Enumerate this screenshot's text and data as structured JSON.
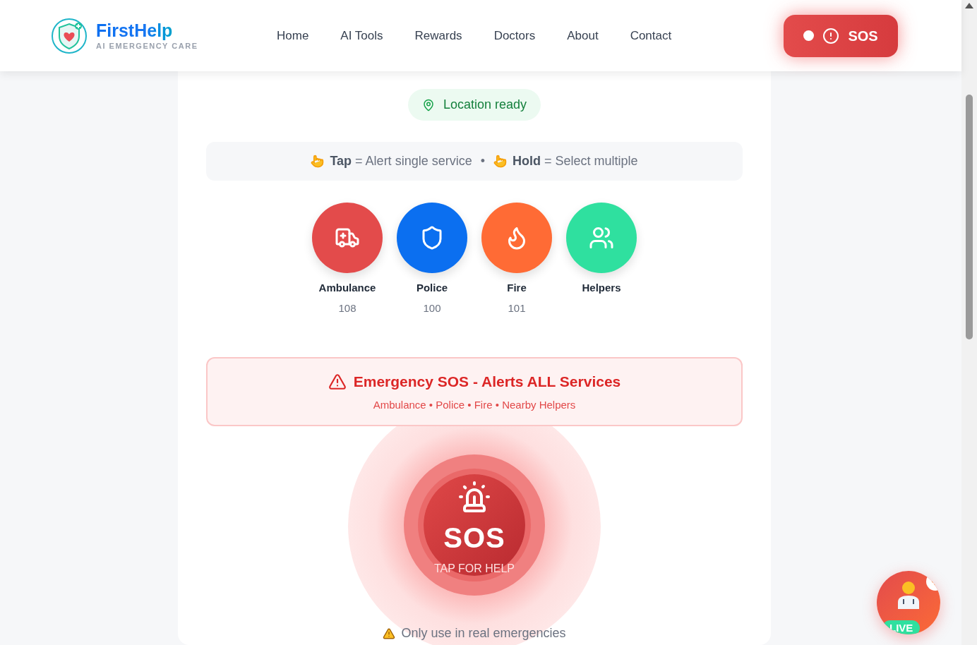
{
  "header": {
    "brand": "FirstHelp",
    "tagline": "AI EMERGENCY CARE",
    "nav": [
      {
        "label": "Home"
      },
      {
        "label": "AI Tools"
      },
      {
        "label": "Rewards"
      },
      {
        "label": "Doctors"
      },
      {
        "label": "About"
      },
      {
        "label": "Contact"
      }
    ],
    "sos_button": {
      "label": "SOS"
    }
  },
  "location_status": "Location ready",
  "hint": {
    "items": [
      "**Tap** = Alert single service",
      "**Hold** = Select multiple"
    ],
    "separator": "•"
  },
  "services": [
    {
      "kind": "ambulance",
      "name": "Ambulance",
      "number": "108",
      "color": "#e34b4b"
    },
    {
      "kind": "police",
      "name": "Police",
      "number": "100",
      "color": "#0b6ff0"
    },
    {
      "kind": "fire",
      "name": "Fire",
      "number": "101",
      "color": "#ff6b35"
    },
    {
      "kind": "helpers",
      "name": "Helpers",
      "color": "#2fe09f"
    }
  ],
  "emergency_banner": {
    "title": "Emergency SOS - Alerts ALL Services",
    "subtitle": "Ambulance • Police • Fire • Nearby Helpers"
  },
  "sos": {
    "label": "SOS",
    "caption": "TAP FOR HELP"
  },
  "warning": "Only use in real emergencies",
  "assistant": {
    "badge": "LIVE"
  }
}
